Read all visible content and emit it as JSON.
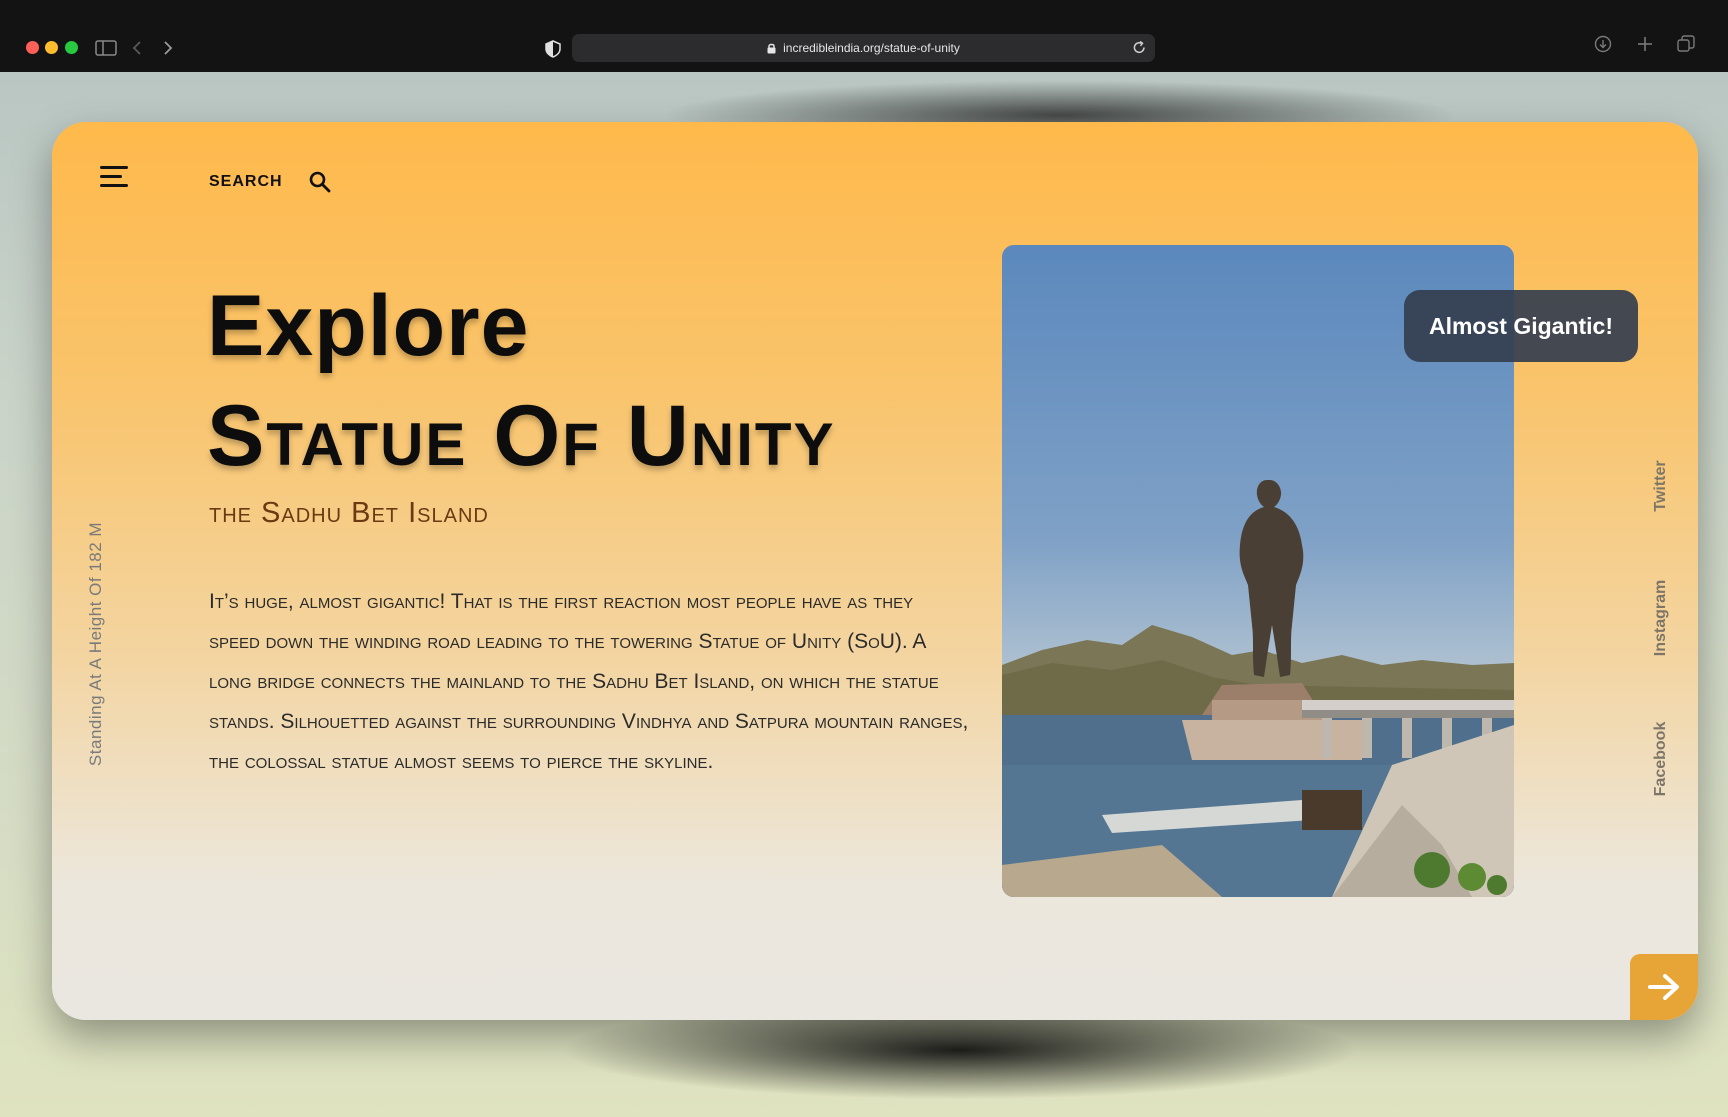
{
  "browser": {
    "url": "incredibleindia.org/statue-of-unity"
  },
  "header": {
    "search_label": "SEARCH"
  },
  "hero": {
    "title_line1": "Explore",
    "title_line2": "Statue Of Unity",
    "subtitle": "the Sadhu Bet Island",
    "body": "It’s huge, almost gigantic! That is the first reaction most people have as they speed down the winding road leading to the towering Statue of Unity (SoU). A long bridge connects the mainland to the Sadhu Bet Island, on which the statue stands. Silhouetted against the surrounding Vindhya and Satpura mountain ranges, the colossal statue almost seems to pierce the skyline.",
    "side_caption": "Standing At A Height Of 182 M"
  },
  "photo": {
    "badge": "Almost Gigantic!"
  },
  "social": {
    "items": [
      "Twitter",
      "Instagram",
      "Facebook"
    ]
  },
  "icons": {
    "menu": "menu-icon",
    "search": "search-icon",
    "next": "arrow-right-icon"
  },
  "colors": {
    "accent": "#e6a536",
    "title": "#0d0d0d",
    "subtitle": "#6b3a12",
    "card_top": "#ffb94b",
    "card_bottom": "#eae7e1"
  }
}
